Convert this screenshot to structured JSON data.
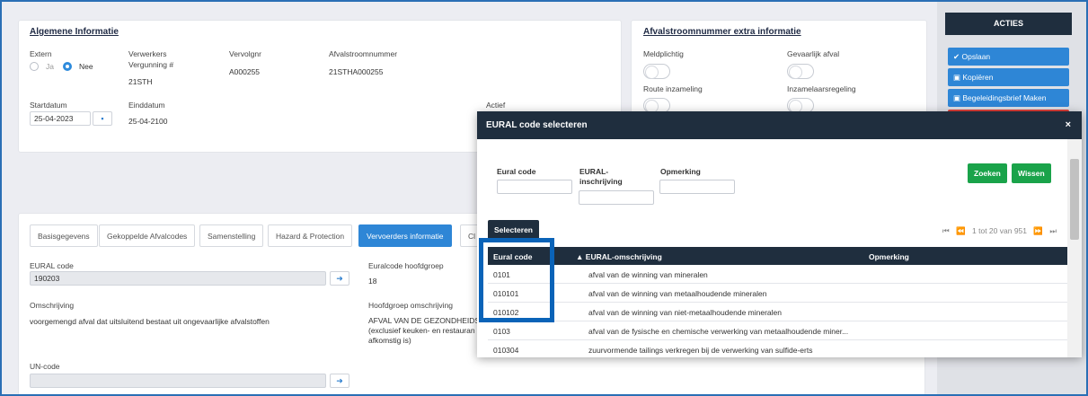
{
  "algemeen": {
    "title": "Algemene Informatie",
    "extern_label": "Extern",
    "ja": "Ja",
    "nee": "Nee",
    "verwerkers_label1": "Verwerkers",
    "verwerkers_label2": "Vergunning #",
    "verwerkers_value": "21STH",
    "volgnr_label": "Vervolgnr",
    "volgnr_value": "A000255",
    "afvalstroom_label": "Afvalstroomnummer",
    "afvalstroom_value": "21STHA000255",
    "start_label": "Startdatum",
    "start_value": "25-04-2023",
    "eind_label": "Einddatum",
    "eind_value": "25-04-2100",
    "actief_label": "Actief"
  },
  "extra": {
    "title": "Afvalstroomnummer extra informatie",
    "meldplichtig": "Meldplichtig",
    "gevaarlijk": "Gevaarlijk afval",
    "route": "Route inzameling",
    "inzamelaar": "Inzamelaarsregeling"
  },
  "tabs": [
    "Basisgegevens",
    "Gekoppelde Afvalcodes",
    "Samenstelling",
    "Hazard & Protection",
    "Vervoerders informatie",
    "Cl"
  ],
  "detail": {
    "eural_label": "EURAL code",
    "eural_value": "190203",
    "hoofdgroep_label": "Euralcode hoofdgroep",
    "hoofdgroep_value": "18",
    "omschrijving_label": "Omschrijving",
    "omschrijving_value": "voorgemengd afval dat uitsluitend bestaat uit ongevaarlijke afvalstoffen",
    "hg_omschrijving_label": "Hoofdgroep omschrijving",
    "hg_line1": "AFVAL VAN DE GEZONDHEIDSZ",
    "hg_line2": "(exclusief keuken- en restauran",
    "hg_line3": "afkomstig is)",
    "un_label": "UN-code"
  },
  "acties": {
    "title": "ACTIES",
    "opslaan": "✔ Opslaan",
    "kopieren": "▣ Kopiëren",
    "brief": "▣ Begeleidingsbrief Maken"
  },
  "modal": {
    "title": "EURAL code selecteren",
    "close": "×",
    "f_code": "Eural code",
    "f_inschr1": "EURAL-",
    "f_inschr2": "inschrijving",
    "f_opm": "Opmerking",
    "zoeken": "Zoeken",
    "wissen": "Wissen",
    "selecteren": "Selecteren",
    "pager": "1 tot 20 van 951",
    "col_code": "Eural code",
    "col_omschr": "▲  EURAL-omschrijving",
    "col_opm": "Opmerking",
    "rows": [
      {
        "code": "0101",
        "desc": "afval van de winning van mineralen"
      },
      {
        "code": "010101",
        "desc": "afval van de winning van metaalhoudende mineralen"
      },
      {
        "code": "010102",
        "desc": "afval van de winning van niet-metaalhoudende mineralen"
      },
      {
        "code": "0103",
        "desc": "afval van de fysische en chemische verwerking van metaalhoudende miner..."
      },
      {
        "code": "010304",
        "desc": "zuurvormende tailings verkregen bij de verwerking van sulfide-erts"
      }
    ]
  }
}
